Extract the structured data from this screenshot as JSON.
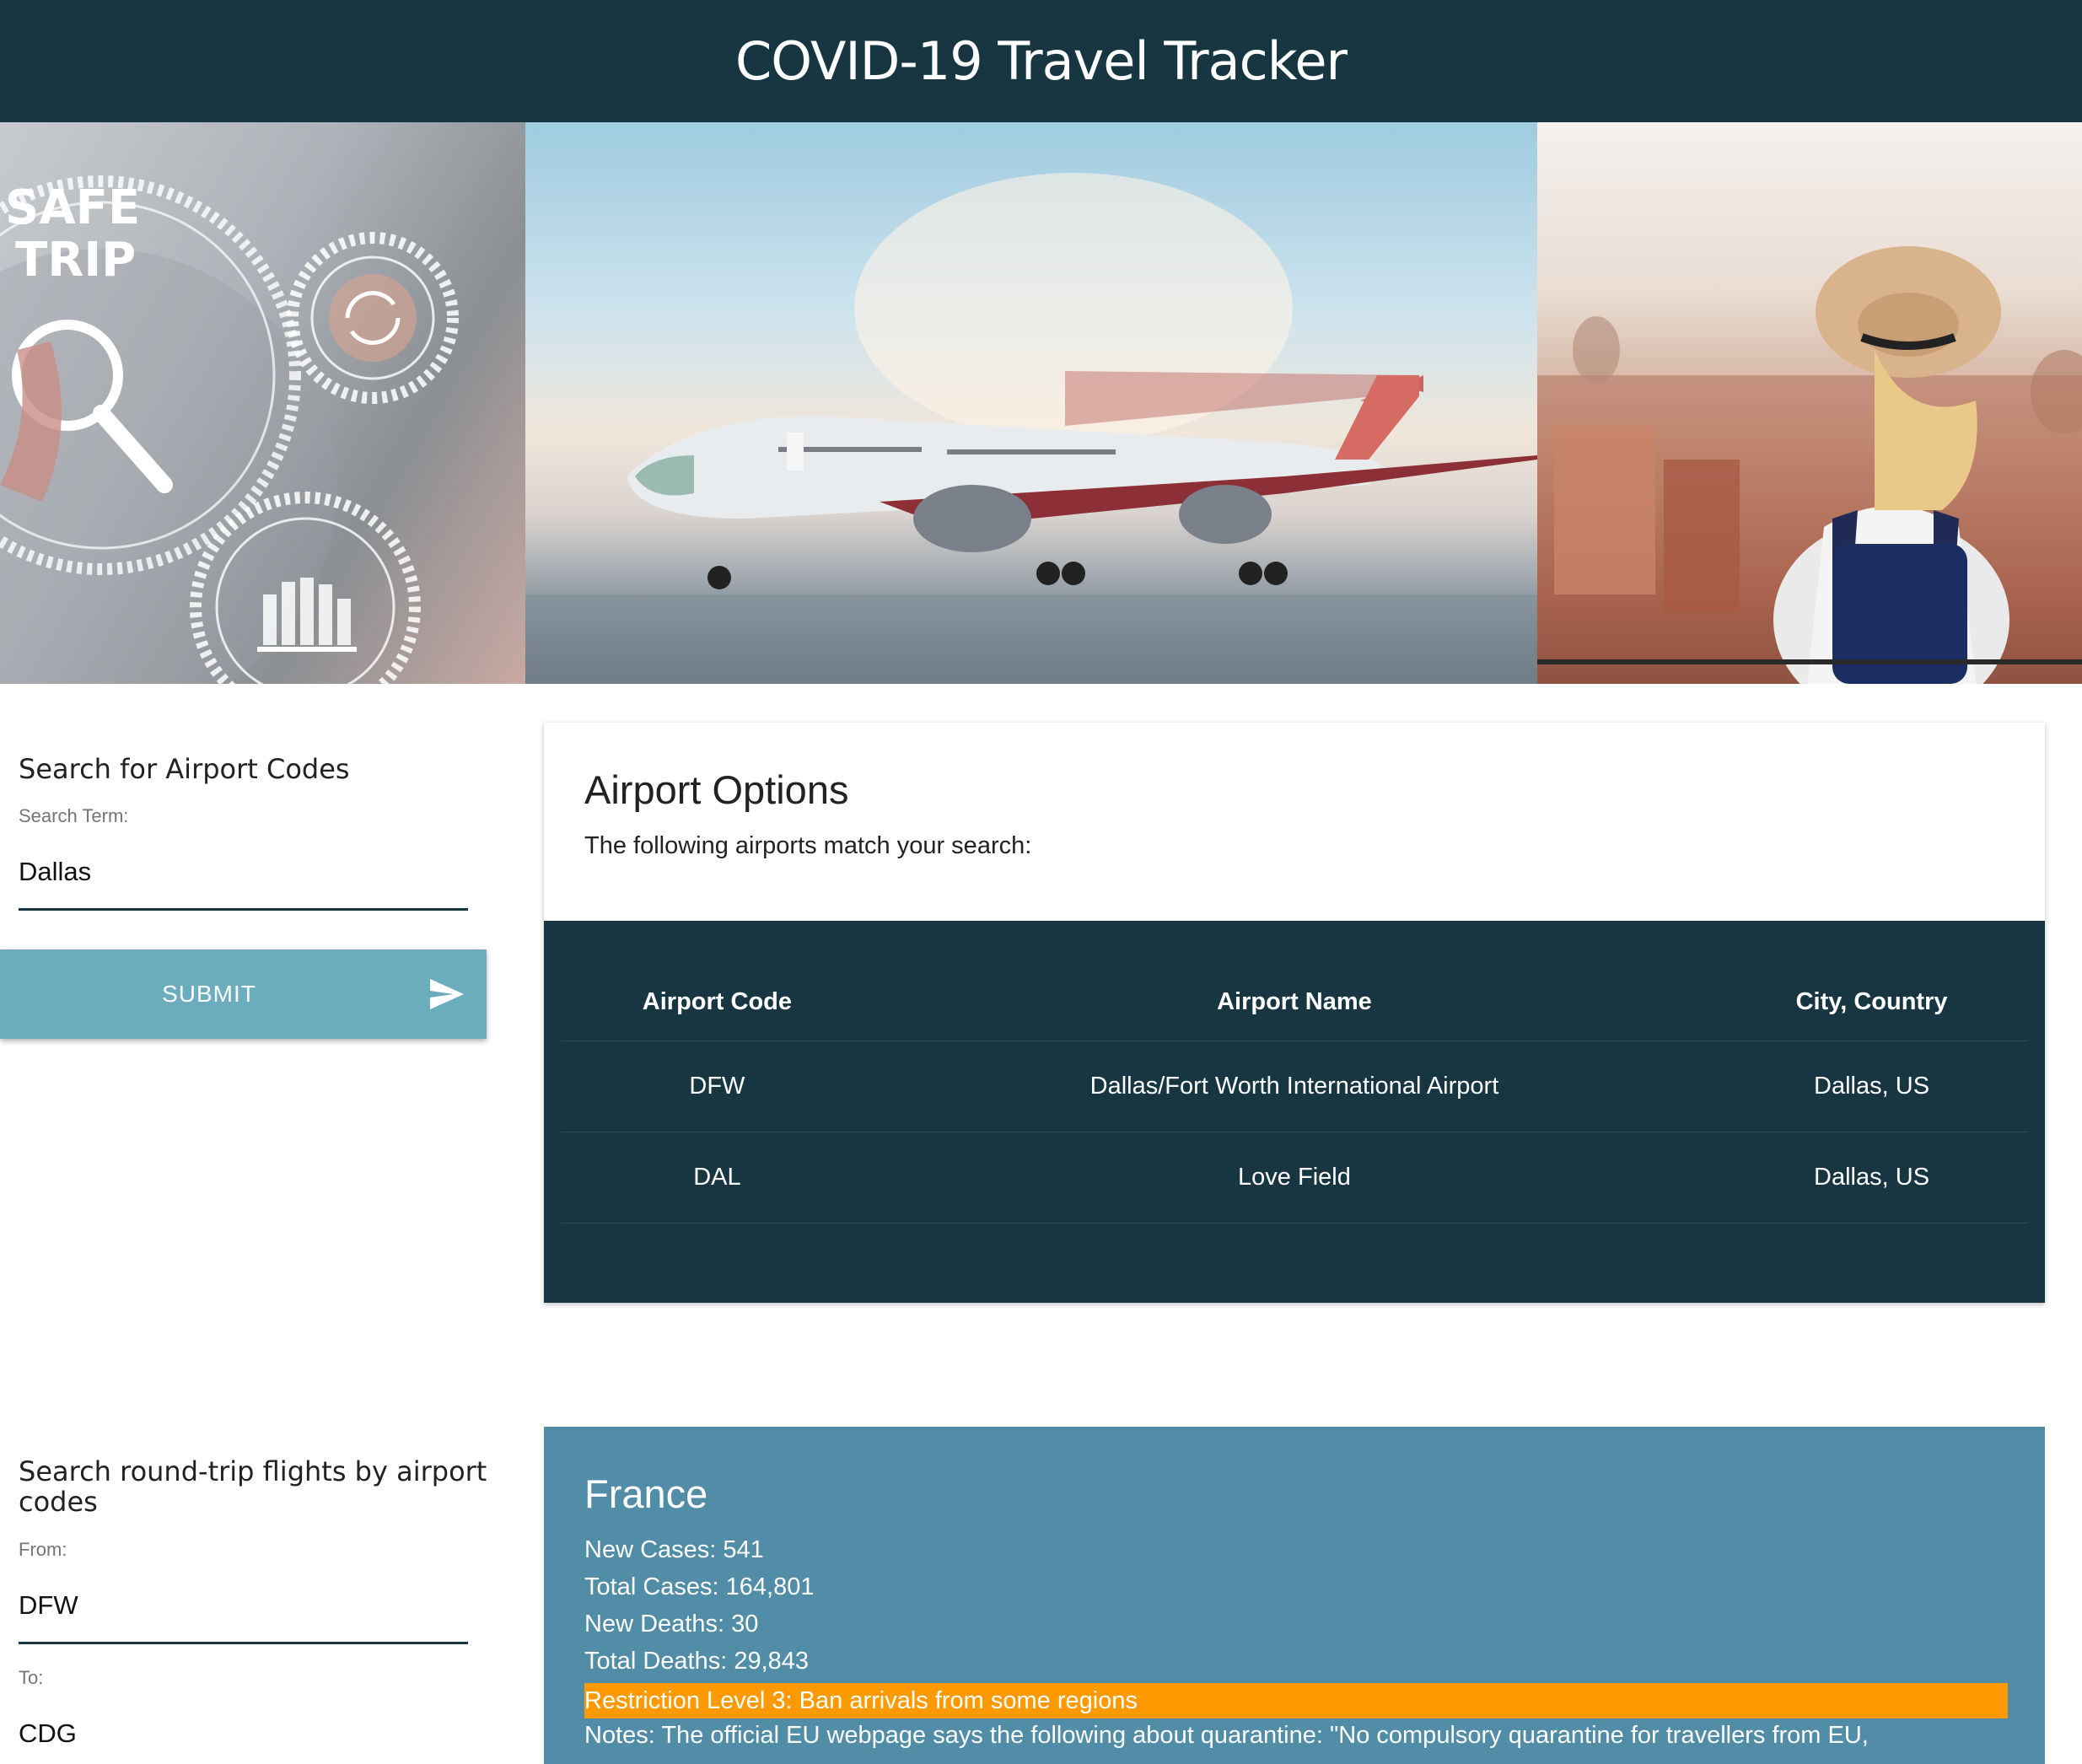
{
  "header": {
    "title": "COVID-19 Travel Tracker"
  },
  "hero": {
    "badge_line1": "SAFE",
    "badge_line2": "TRIP"
  },
  "airport_search": {
    "title": "Search for Airport Codes",
    "field_label": "Search Term:",
    "value": "Dallas",
    "submit_label": "SUBMIT"
  },
  "airport_options": {
    "title": "Airport Options",
    "subtitle": "The following airports match your search:",
    "columns": [
      "Airport Code",
      "Airport Name",
      "City, Country"
    ],
    "rows": [
      [
        "DFW",
        "Dallas/Fort Worth International Airport",
        "Dallas, US"
      ],
      [
        "DAL",
        "Love Field",
        "Dallas, US"
      ]
    ]
  },
  "flight_search": {
    "title": "Search round-trip flights by airport codes",
    "from_label": "From:",
    "from_value": "DFW",
    "to_label": "To:",
    "to_value": "CDG"
  },
  "country": {
    "name": "France",
    "new_cases": "New Cases: 541",
    "total_cases": "Total Cases: 164,801",
    "new_deaths": "New Deaths: 30",
    "total_deaths": "Total Deaths: 29,843",
    "restriction": "Restriction Level 3: Ban arrivals from some regions",
    "notes": "Notes: The official EU webpage says the following about quarantine: \"No compulsory quarantine for travellers from EU,"
  },
  "colors": {
    "header_bg": "#183642",
    "table_bg": "#183642",
    "button_bg": "#6cadbd",
    "country_card_bg": "#518da6",
    "restriction_bg": "#ff9900"
  }
}
